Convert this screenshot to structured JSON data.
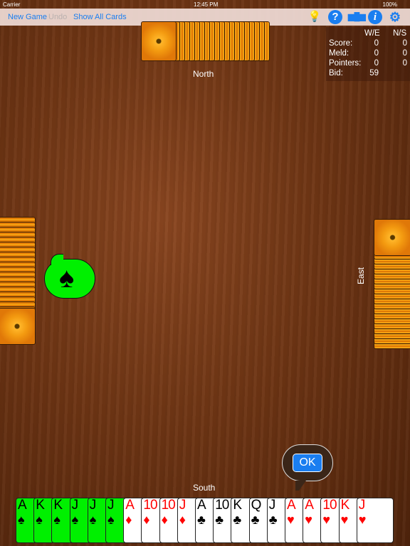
{
  "status": {
    "carrier": "Carrier",
    "time": "12:45 PM",
    "battery": "100%"
  },
  "toolbar": {
    "new_game": "New Game",
    "undo": "Undo",
    "show_all": "Show All Cards",
    "icons": [
      "hint-lightbulb-icon",
      "help-icon",
      "leaderboard-icon",
      "info-icon",
      "settings-gear-icon"
    ]
  },
  "score": {
    "headers": [
      "W/E",
      "N/S"
    ],
    "rows": [
      {
        "label": "Score:",
        "we": "0",
        "ns": "0"
      },
      {
        "label": "Meld:",
        "we": "0",
        "ns": "0"
      },
      {
        "label": "Pointers:",
        "we": "0",
        "ns": "0"
      },
      {
        "label": "Bid:",
        "we": "59",
        "ns": ""
      }
    ]
  },
  "players": {
    "north": "North",
    "south": "South",
    "east": "East"
  },
  "trump": {
    "suit": "♠",
    "color": "#00f000"
  },
  "ok_button": "OK",
  "hand": [
    {
      "rank": "A",
      "suit": "♠",
      "selected": true
    },
    {
      "rank": "K",
      "suit": "♠",
      "selected": true
    },
    {
      "rank": "K",
      "suit": "♠",
      "selected": true
    },
    {
      "rank": "J",
      "suit": "♠",
      "selected": true
    },
    {
      "rank": "J",
      "suit": "♠",
      "selected": true
    },
    {
      "rank": "J",
      "suit": "♠",
      "selected": true
    },
    {
      "rank": "A",
      "suit": "♦",
      "selected": false
    },
    {
      "rank": "10",
      "suit": "♦",
      "selected": false
    },
    {
      "rank": "10",
      "suit": "♦",
      "selected": false
    },
    {
      "rank": "J",
      "suit": "♦",
      "selected": false
    },
    {
      "rank": "A",
      "suit": "♣",
      "selected": false
    },
    {
      "rank": "10",
      "suit": "♣",
      "selected": false
    },
    {
      "rank": "K",
      "suit": "♣",
      "selected": false
    },
    {
      "rank": "Q",
      "suit": "♣",
      "selected": false
    },
    {
      "rank": "J",
      "suit": "♣",
      "selected": false
    },
    {
      "rank": "A",
      "suit": "♥",
      "selected": false
    },
    {
      "rank": "A",
      "suit": "♥",
      "selected": false
    },
    {
      "rank": "10",
      "suit": "♥",
      "selected": false
    },
    {
      "rank": "K",
      "suit": "♥",
      "selected": false
    },
    {
      "rank": "J",
      "suit": "♥",
      "selected": false
    }
  ]
}
